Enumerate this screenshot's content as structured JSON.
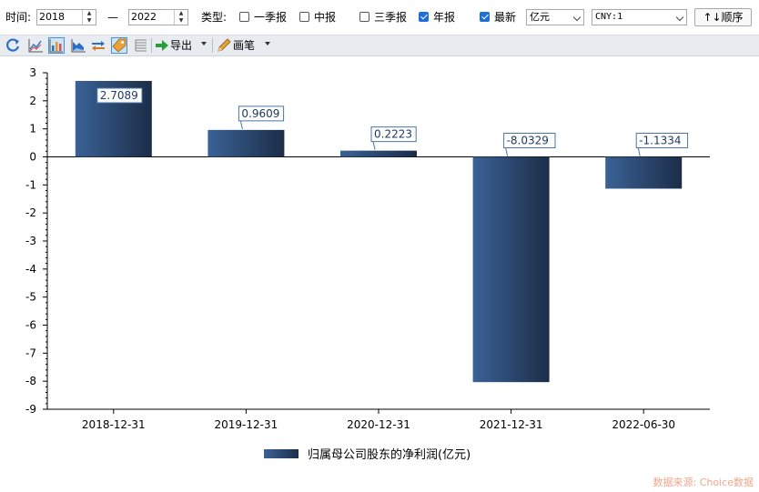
{
  "filter": {
    "time_label": "时间:",
    "start_year": "2018",
    "dash": "—",
    "end_year": "2022",
    "type_label": "类型:",
    "checkboxes": [
      {
        "label": "一季报",
        "checked": false
      },
      {
        "label": "中报",
        "checked": false
      },
      {
        "label": "三季报",
        "checked": false
      },
      {
        "label": "年报",
        "checked": true
      },
      {
        "label": "最新",
        "checked": true
      }
    ],
    "unit_select": "亿元",
    "currency_select": "CNY:1",
    "order_button": "↑↓顺序"
  },
  "toolbar": {
    "export_label": "导出",
    "draw_label": "画笔"
  },
  "chart_data": {
    "type": "bar",
    "categories": [
      "2018-12-31",
      "2019-12-31",
      "2020-12-31",
      "2021-12-31",
      "2022-06-30"
    ],
    "series": [
      {
        "name": "归属母公司股东的净利润(亿元)",
        "values": [
          2.7089,
          0.9609,
          0.2223,
          -8.0329,
          -1.1334
        ]
      }
    ],
    "data_labels": [
      "2.7089",
      "0.9609",
      "0.2223",
      "-8.0329",
      "-1.1334"
    ],
    "ylim": [
      -9,
      3
    ],
    "yticks": [
      "3",
      "2",
      "1",
      "0",
      "-1",
      "-2",
      "-3",
      "-4",
      "-5",
      "-6",
      "-7",
      "-8",
      "-9"
    ],
    "legend_position": "bottom",
    "colors": {
      "bar_dark": "#1c2d48",
      "bar_light": "#3a6296",
      "label_border": "#4a74a8",
      "label_text": "#1f3a60"
    }
  },
  "source_text": "数据来源: Choice数据"
}
